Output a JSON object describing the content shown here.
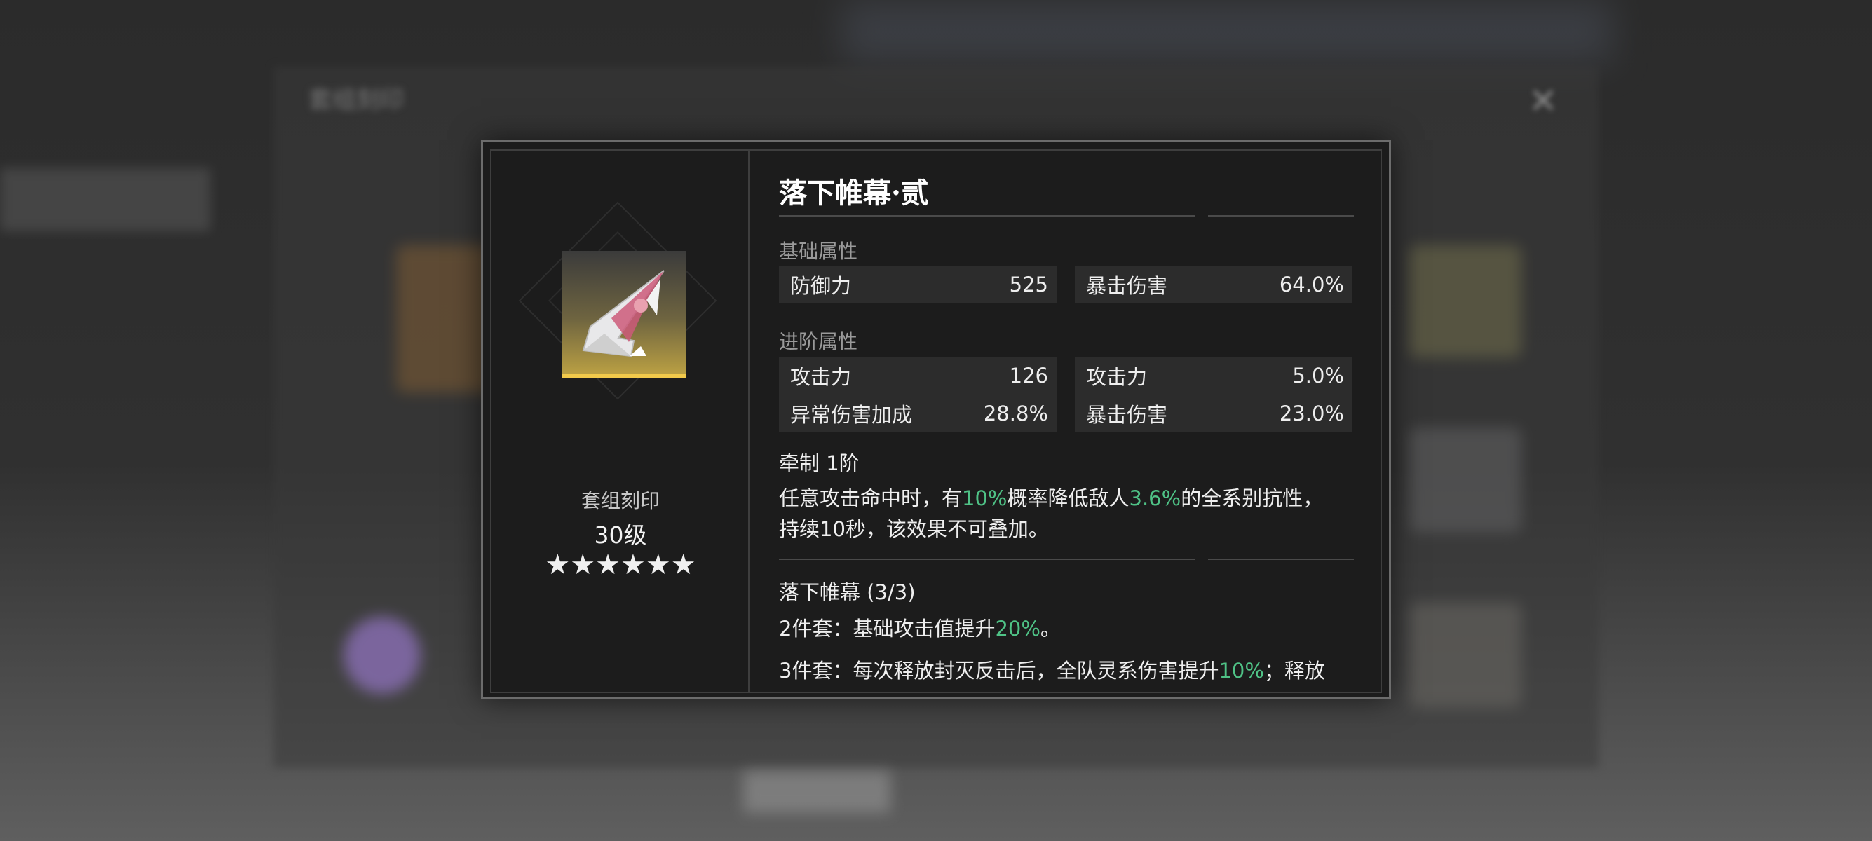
{
  "background": {
    "window_title": "套组刻印"
  },
  "item": {
    "name": "落下帷幕·贰",
    "set_label": "套组刻印",
    "level": "30级",
    "stars": "★★★★★★",
    "icon": "shard-icon"
  },
  "base_stats": {
    "label": "基础属性",
    "left": {
      "name": "防御力",
      "value": "525"
    },
    "right": {
      "name": "暴击伤害",
      "value": "64.0%"
    }
  },
  "advanced_stats": {
    "label": "进阶属性",
    "rows": [
      {
        "left": {
          "name": "攻击力",
          "value": "126"
        },
        "right": {
          "name": "攻击力",
          "value": "5.0%"
        }
      },
      {
        "left": {
          "name": "异常伤害加成",
          "value": "28.8%"
        },
        "right": {
          "name": "暴击伤害",
          "value": "23.0%"
        }
      }
    ]
  },
  "restraint": {
    "title": "牵制 1阶",
    "line1_a": "任意攻击命中时，有",
    "line1_b": "10%",
    "line1_c": "概率降低敌人",
    "line1_d": "3.6%",
    "line1_e": "的全系别抗性，",
    "line2": "持续10秒，该效果不可叠加。"
  },
  "set_bonus": {
    "title": "落下帷幕 (3/3)",
    "two_piece_a": "2件套：基础攻击值提升",
    "two_piece_b": "20%",
    "two_piece_c": "。",
    "three_piece_a": "3件套：每次释放封灭反击后，全队灵系伤害提升",
    "three_piece_b": "10%",
    "three_piece_c": "；释放"
  },
  "colors": {
    "highlight_pink": "#e94d86",
    "highlight_green": "#4fc286",
    "rarity_gold": "#f1c94b"
  }
}
